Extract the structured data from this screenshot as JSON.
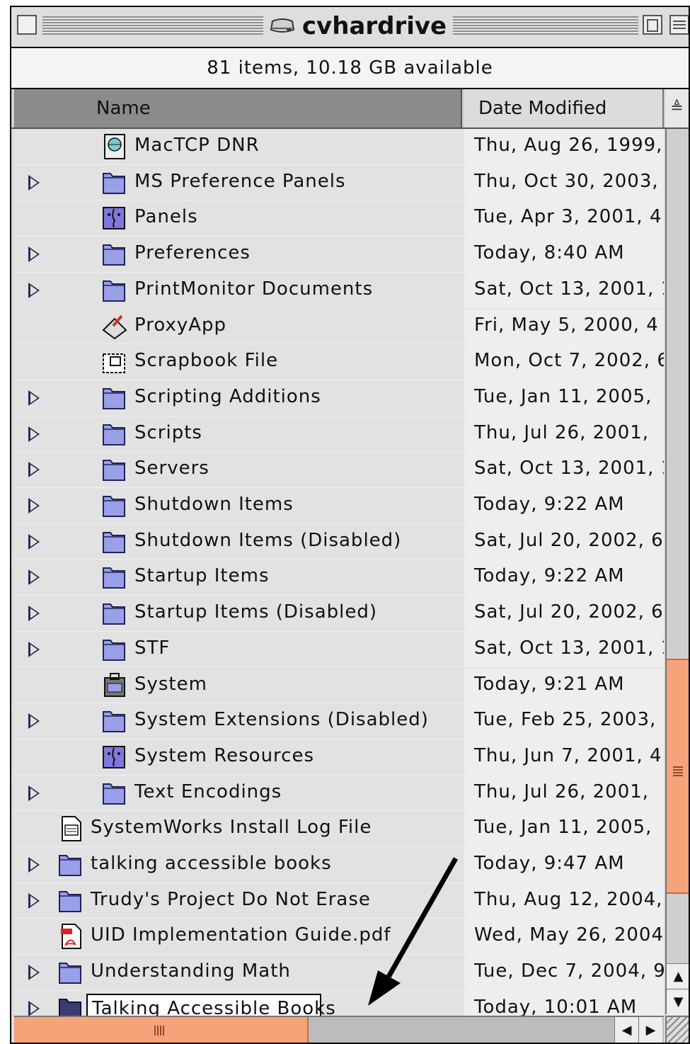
{
  "window": {
    "title": "cvhardrive",
    "info": "81 items, 10.18 GB available"
  },
  "header": {
    "name_col": "Name",
    "date_col": "Date Modified"
  },
  "rows": [
    {
      "name": "MacTCP DNR",
      "date": "Thu, Aug 26, 1999,",
      "indent": 1,
      "expandable": false,
      "icon": "control-panel-globe-icon"
    },
    {
      "name": "MS Preference Panels",
      "date": "Thu, Oct 30, 2003,",
      "indent": 1,
      "expandable": true,
      "icon": "folder-icon"
    },
    {
      "name": "Panels",
      "date": "Tue, Apr 3, 2001, 4",
      "indent": 1,
      "expandable": false,
      "icon": "mac-os-face-icon"
    },
    {
      "name": "Preferences",
      "date": "Today, 8:40 AM",
      "indent": 1,
      "expandable": true,
      "icon": "preferences-folder-icon"
    },
    {
      "name": "PrintMonitor Documents",
      "date": "Sat, Oct 13, 2001, 1",
      "indent": 1,
      "expandable": true,
      "icon": "printer-folder-icon"
    },
    {
      "name": "ProxyApp",
      "date": "Fri, May 5, 2000, 4",
      "indent": 1,
      "expandable": false,
      "icon": "application-icon"
    },
    {
      "name": "Scrapbook File",
      "date": "Mon, Oct 7, 2002, 6",
      "indent": 1,
      "expandable": false,
      "icon": "scrapbook-file-icon"
    },
    {
      "name": "Scripting Additions",
      "date": "Tue, Jan 11, 2005,",
      "indent": 1,
      "expandable": true,
      "icon": "script-folder-icon"
    },
    {
      "name": "Scripts",
      "date": "Thu, Jul 26, 2001,",
      "indent": 1,
      "expandable": true,
      "icon": "script-folder-icon"
    },
    {
      "name": "Servers",
      "date": "Sat, Oct 13, 2001, 1",
      "indent": 1,
      "expandable": true,
      "icon": "folder-icon"
    },
    {
      "name": "Shutdown Items",
      "date": "Today, 9:22 AM",
      "indent": 1,
      "expandable": true,
      "icon": "power-folder-icon"
    },
    {
      "name": "Shutdown Items (Disabled)",
      "date": "Sat, Jul 20, 2002, 6",
      "indent": 1,
      "expandable": true,
      "icon": "power-folder-disabled-icon"
    },
    {
      "name": "Startup Items",
      "date": "Today, 9:22 AM",
      "indent": 1,
      "expandable": true,
      "icon": "power-folder-icon"
    },
    {
      "name": "Startup Items (Disabled)",
      "date": "Sat, Jul 20, 2002, 6",
      "indent": 1,
      "expandable": true,
      "icon": "power-folder-disabled-icon"
    },
    {
      "name": "STF",
      "date": "Sat, Oct 13, 2001, 1",
      "indent": 1,
      "expandable": true,
      "icon": "stf-folder-icon"
    },
    {
      "name": "System",
      "date": "Today, 9:21 AM",
      "indent": 1,
      "expandable": false,
      "icon": "system-suitcase-icon"
    },
    {
      "name": "System Extensions (Disabled)",
      "date": "Tue, Feb 25, 2003,",
      "indent": 1,
      "expandable": true,
      "icon": "extensions-folder-disabled-icon"
    },
    {
      "name": "System Resources",
      "date": "Thu, Jun 7, 2001, 4",
      "indent": 1,
      "expandable": false,
      "icon": "mac-os-face-icon"
    },
    {
      "name": "Text Encodings",
      "date": "Thu, Jul 26, 2001,",
      "indent": 1,
      "expandable": true,
      "icon": "text-encodings-folder-icon"
    },
    {
      "name": "SystemWorks Install Log File",
      "date": "Tue, Jan 11, 2005,",
      "indent": 0,
      "expandable": false,
      "icon": "text-document-icon"
    },
    {
      "name": "talking accessible books",
      "date": "Today, 9:47 AM",
      "indent": 0,
      "expandable": true,
      "icon": "folder-icon"
    },
    {
      "name": "Trudy's Project Do Not Erase",
      "date": "Thu, Aug 12, 2004,",
      "indent": 0,
      "expandable": true,
      "icon": "project-folder-icon"
    },
    {
      "name": "UID Implementation Guide.pdf",
      "date": "Wed, May 26, 2004",
      "indent": 0,
      "expandable": false,
      "icon": "pdf-document-icon"
    },
    {
      "name": "Understanding Math",
      "date": "Tue, Dec 7, 2004, 9",
      "indent": 0,
      "expandable": true,
      "icon": "folder-icon"
    },
    {
      "name": "Talking Accessible Books",
      "date": "Today, 10:01 AM",
      "indent": 0,
      "expandable": true,
      "icon": "folder-selected-icon",
      "editing": true
    }
  ],
  "colors": {
    "scroll_thumb": "#f7a37a",
    "name_header_sorted": "#8b8b8b",
    "folder": "#9aa0e8"
  }
}
